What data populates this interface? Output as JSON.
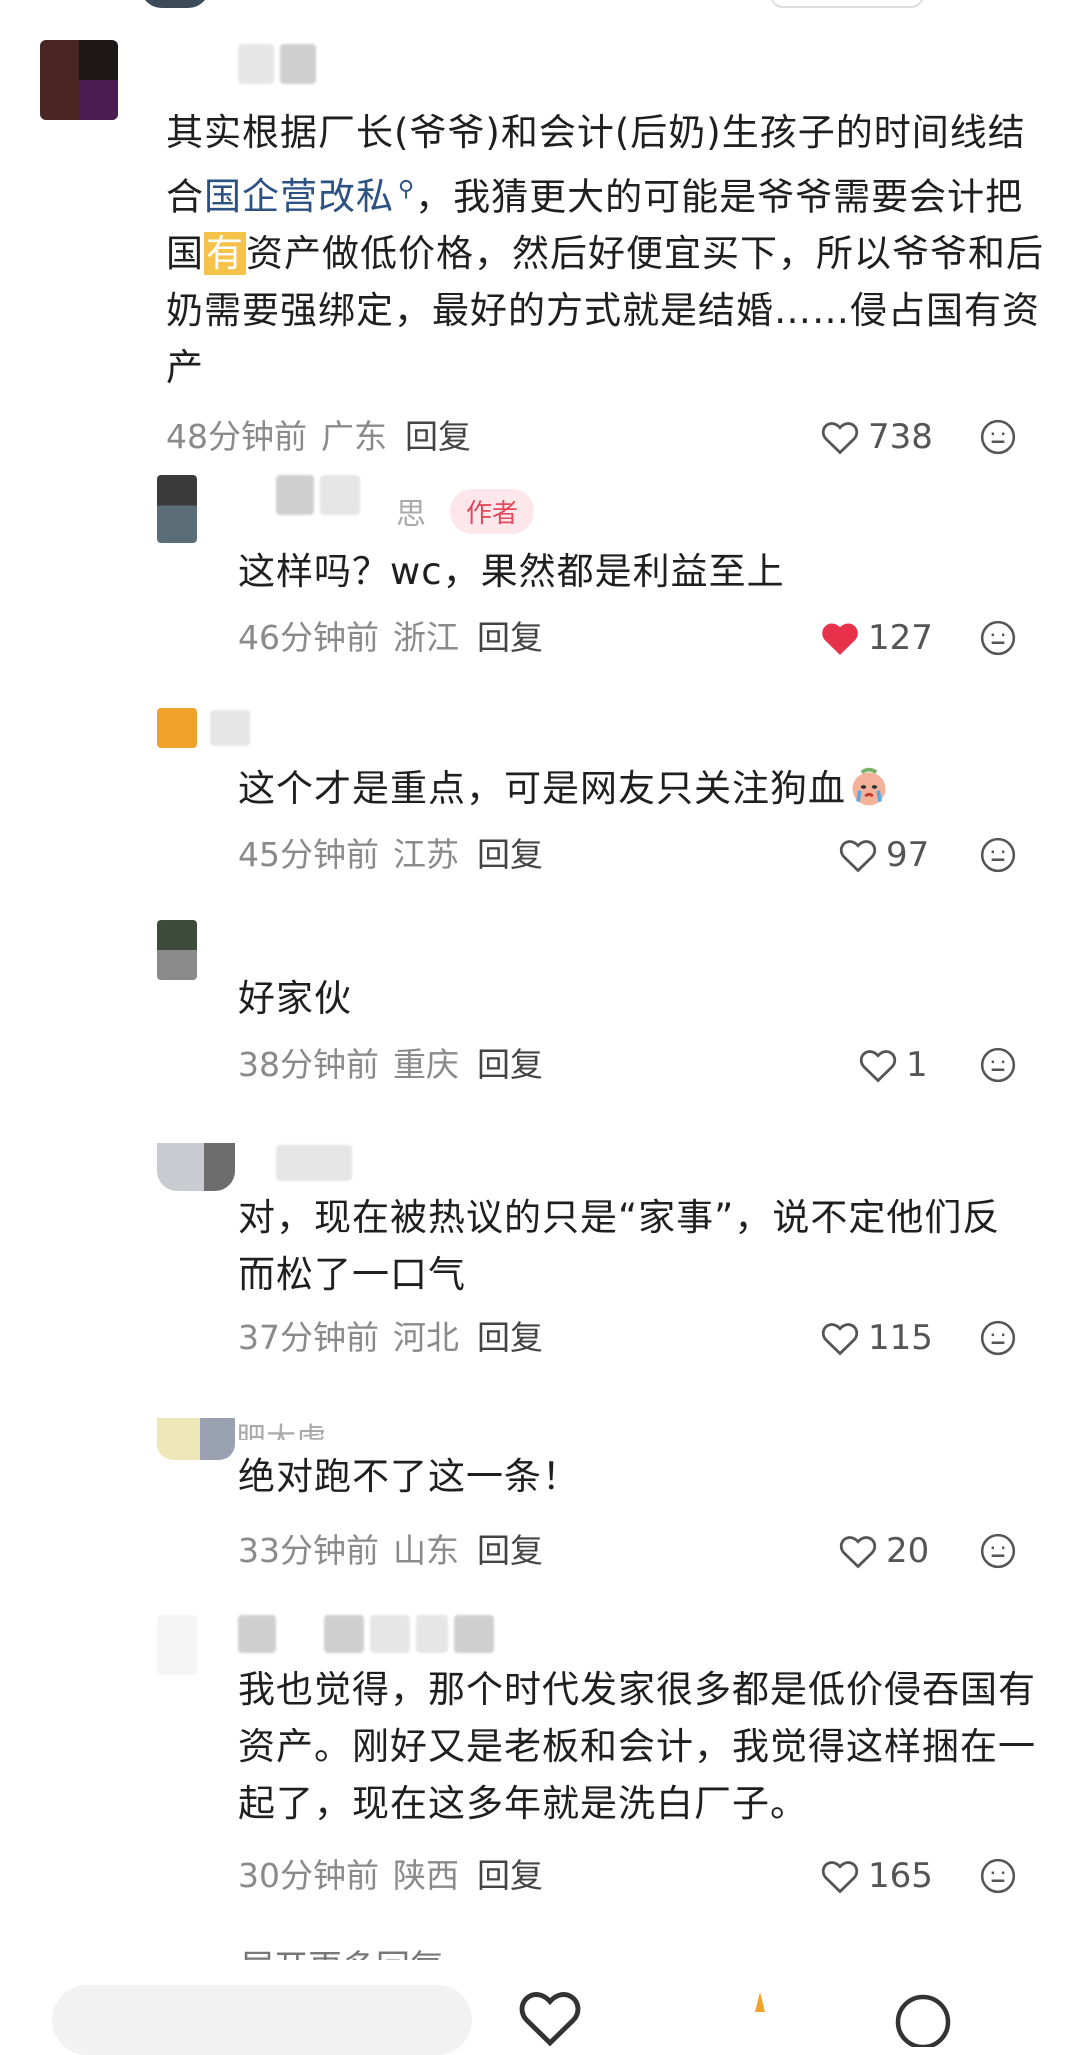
{
  "comments": [
    {
      "text_before_link": "其实根据厂长(爷爷)和会计(后奶)生孩子的时间线结合",
      "link": "国企营改私",
      "text_mid": "，我猜更大的可能是爷爷需要会计把国",
      "highlight": "有",
      "text_after": "资产做低价格，然后好便宜买下，所以爷爷和后奶需要强绑定，最好的方式就是结婚……侵占国有资产",
      "time": "48分钟前",
      "location": "广东",
      "reply_label": "回复",
      "likes": "738",
      "liked": false
    },
    {
      "author_tag": "作者",
      "name_fragment": "思",
      "text": "这样吗？wc，果然都是利益至上",
      "time": "46分钟前",
      "location": "浙江",
      "reply_label": "回复",
      "likes": "127",
      "liked": true
    },
    {
      "text": "这个才是重点，可是网友只关注狗血",
      "time": "45分钟前",
      "location": "江苏",
      "reply_label": "回复",
      "likes": "97",
      "liked": false
    },
    {
      "text": "好家伙",
      "time": "38分钟前",
      "location": "重庆",
      "reply_label": "回复",
      "likes": "1",
      "liked": false
    },
    {
      "text": "对，现在被热议的只是“家事”，说不定他们反而松了一口气",
      "time": "37分钟前",
      "location": "河北",
      "reply_label": "回复",
      "likes": "115",
      "liked": false
    },
    {
      "name_fragment": "肥大虎",
      "text": "绝对跑不了这一条！",
      "time": "33分钟前",
      "location": "山东",
      "reply_label": "回复",
      "likes": "20",
      "liked": false
    },
    {
      "text": "我也觉得，那个时代发家很多都是低价侵吞国有资产。刚好又是老板和会计，我觉得这样捆在一起了，现在这多年就是洗白厂子。",
      "time": "30分钟前",
      "location": "陕西",
      "reply_label": "回复",
      "likes": "165",
      "liked": false
    }
  ],
  "more_replies": "展开更多回复",
  "colors": {
    "liked_heart": "#e8324b",
    "link": "#2c5283",
    "author_tag": "#e04a5c"
  },
  "icons": [
    "heart-icon",
    "emoji-face-icon",
    "crying-emoji-icon"
  ]
}
